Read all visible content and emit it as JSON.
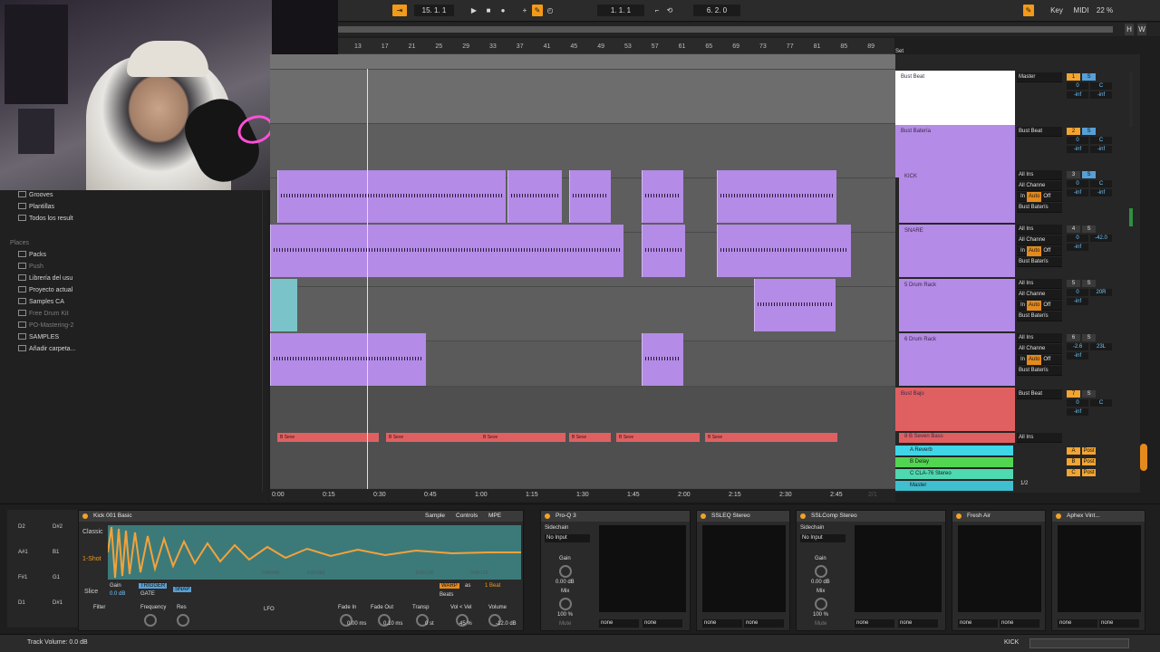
{
  "transport": {
    "tempo": "15. 1. 1",
    "position": "1. 1. 1",
    "loop_length": "6. 2. 0",
    "key_label": "Key",
    "midi_label": "MIDI",
    "cpu": "22 %"
  },
  "ruler": {
    "bars": [
      "13",
      "17",
      "21",
      "25",
      "29",
      "33",
      "37",
      "41",
      "45",
      "49",
      "53",
      "57",
      "61",
      "65",
      "69",
      "73",
      "77",
      "81",
      "85",
      "89"
    ]
  },
  "timeline": [
    "0:00",
    "0:15",
    "0:30",
    "0:45",
    "1:00",
    "1:15",
    "1:30",
    "1:45",
    "2:00",
    "2:15",
    "2:30",
    "2:45"
  ],
  "page_indicator": "2/1",
  "browser": {
    "collections": [
      "Grooves",
      "Plantillas",
      "Todos los result"
    ],
    "places_label": "Places",
    "places": [
      "Packs",
      "Push",
      "Librería del usu",
      "Proyecto actual",
      "Samples CA",
      "Free Drum Kit",
      "PO-Mastering-2",
      "SAMPLES",
      "Añadir carpeta..."
    ]
  },
  "set_label": "Set",
  "tracks": [
    {
      "name": "Bust Beat",
      "input": "Master",
      "vol": "0",
      "pan": "C",
      "color": "#ffffff"
    },
    {
      "name": "Bust Batería",
      "input": "Bust Beat",
      "vol": "0",
      "pan": "C",
      "color": "#b48be6"
    },
    {
      "name": "KICK",
      "input": "All Ins",
      "channel": "All Channe",
      "output": "Bust Baterís",
      "vol": "0",
      "pan": "C",
      "color": "#b48be6"
    },
    {
      "name": "SNARE",
      "input": "All Ins",
      "channel": "All Channe",
      "output": "Bust Baterís",
      "vol": "0",
      "pan": "-42.0",
      "color": "#b48be6"
    },
    {
      "name": "5 Drum Rack",
      "input": "All Ins",
      "channel": "All Channe",
      "output": "Bust Baterís",
      "vol": "0",
      "pan": "20R",
      "color": "#b48be6"
    },
    {
      "name": "6 Drum Rack",
      "input": "All Ins",
      "channel": "All Channe",
      "output": "Bust Baterís",
      "vol": "-2.6",
      "pan": "23L",
      "color": "#b48be6"
    },
    {
      "name": "Bust Bajo",
      "input": "Bust Beat",
      "vol": "0",
      "pan": "C",
      "color": "#e06062"
    },
    {
      "name": "8 B Seven Bass",
      "input": "All Ins",
      "color": "#e06062"
    }
  ],
  "io": {
    "in": "In",
    "auto": "Auto",
    "off": "Off",
    "inf": "-inf"
  },
  "returns": [
    {
      "name": "A Reverb",
      "letter": "A",
      "color": "#3fd6e8"
    },
    {
      "name": "B Delay",
      "letter": "B",
      "color": "#52d652"
    },
    {
      "name": "C CLA-76 Stereo",
      "letter": "C",
      "color": "#4fd9b0"
    },
    {
      "name": "Master",
      "color": "#3fbfd0",
      "routing": "1/2"
    }
  ],
  "post_label": "Post",
  "clip_label": "B Seve",
  "devices": {
    "simpler": {
      "title": "Kick 001 Basic",
      "tabs": [
        "Sample",
        "Controls",
        "MPE"
      ],
      "modes": [
        "Classic",
        "1-Shot",
        "Slice"
      ],
      "gain_label": "Gain",
      "gain": "0.0 dB",
      "trigger": "TRIGGER",
      "gate": "GATE",
      "snap": "SNAP",
      "warp": "WARP",
      "as": "as",
      "beat": "1 Beat",
      "beats": "Beats",
      "wave_times": [
        "0:00:040",
        "0:00:060",
        "0:00:100",
        "0:00:120"
      ],
      "filter": "Filter",
      "frequency": "Frequency",
      "res": "Res",
      "lfo": "LFO",
      "fade_in": "Fade In",
      "fade_in_val": "0.00 ms",
      "fade_out": "Fade Out",
      "fade_out_val": "0.10 ms",
      "transp": "Transp",
      "transp_val": "0 st",
      "vol_vel": "Vol < Vel",
      "vol_vel_val": "45 %",
      "volume": "Volume",
      "volume_val": "-12.0 dB",
      "pads": [
        "D2",
        "D#2",
        "A#1",
        "B1",
        "F#1",
        "G1",
        "D1",
        "D#1"
      ]
    },
    "pro_q": {
      "title": "Pro-Q 3",
      "sidechain": "Sidechain",
      "no_input": "No Input",
      "gain": "Gain",
      "gain_val": "0.00 dB",
      "mix": "Mix",
      "mix_val": "100 %",
      "mute": "Mute",
      "none": "none"
    },
    "ssleq": {
      "title": "SSLEQ Stereo",
      "none": "none"
    },
    "sslcomp": {
      "title": "SSLComp Stereo",
      "sidechain": "Sidechain",
      "no_input": "No Input",
      "gain": "Gain",
      "gain_val": "0.00 dB",
      "mix": "Mix",
      "mix_val": "100 %",
      "mute": "Mute",
      "none": "none"
    },
    "fresh_air": {
      "title": "Fresh Air",
      "none": "none"
    },
    "aphex": {
      "title": "Aphex Vint...",
      "none": "none"
    }
  },
  "status": {
    "message": "Track Volume: 0.0 dB",
    "track": "KICK"
  }
}
